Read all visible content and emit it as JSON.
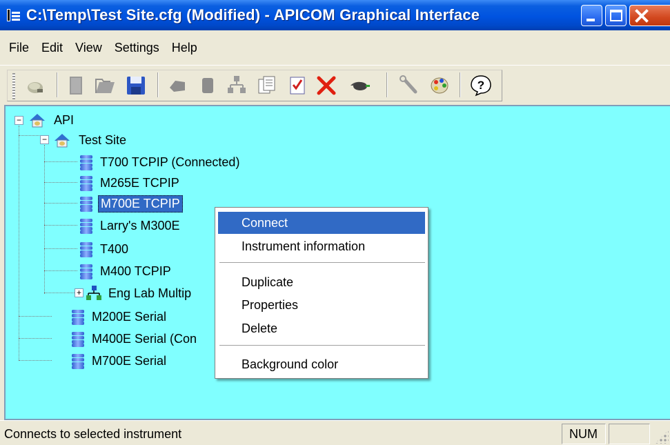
{
  "window": {
    "title": "C:\\Temp\\Test Site.cfg (Modified) - APICOM Graphical Interface"
  },
  "menubar": {
    "items": [
      "File",
      "Edit",
      "View",
      "Settings",
      "Help"
    ]
  },
  "toolbar": {
    "icons": [
      "connect-plug-icon",
      "new-doc-icon",
      "open-icon",
      "save-icon",
      "instrument-gray-icon",
      "instrument-stack-icon",
      "network-icon",
      "copy-icon",
      "checklist-icon",
      "delete-x-icon",
      "cable-icon",
      "wrench-icon",
      "palette-icon",
      "help-icon"
    ]
  },
  "tree": {
    "background": "#80ffff",
    "nodes": [
      {
        "label": "API"
      },
      {
        "label": "Test Site"
      },
      {
        "label": "T700 TCPIP (Connected)"
      },
      {
        "label": "M265E TCPIP"
      },
      {
        "label": "M700E TCPIP"
      },
      {
        "label": "Larry's  M300E"
      },
      {
        "label": "T400"
      },
      {
        "label": "M400 TCPIP"
      },
      {
        "label": "Eng Lab Multip"
      },
      {
        "label": "M200E Serial"
      },
      {
        "label": "M400E Serial (Con"
      },
      {
        "label": "M700E Serial"
      }
    ]
  },
  "context_menu": {
    "items": [
      {
        "label": "Connect"
      },
      {
        "label": "Instrument information"
      },
      {
        "label": "Duplicate"
      },
      {
        "label": "Properties"
      },
      {
        "label": "Delete"
      },
      {
        "label": "Background color"
      }
    ]
  },
  "statusbar": {
    "text": "Connects to selected instrument",
    "num": "NUM"
  }
}
